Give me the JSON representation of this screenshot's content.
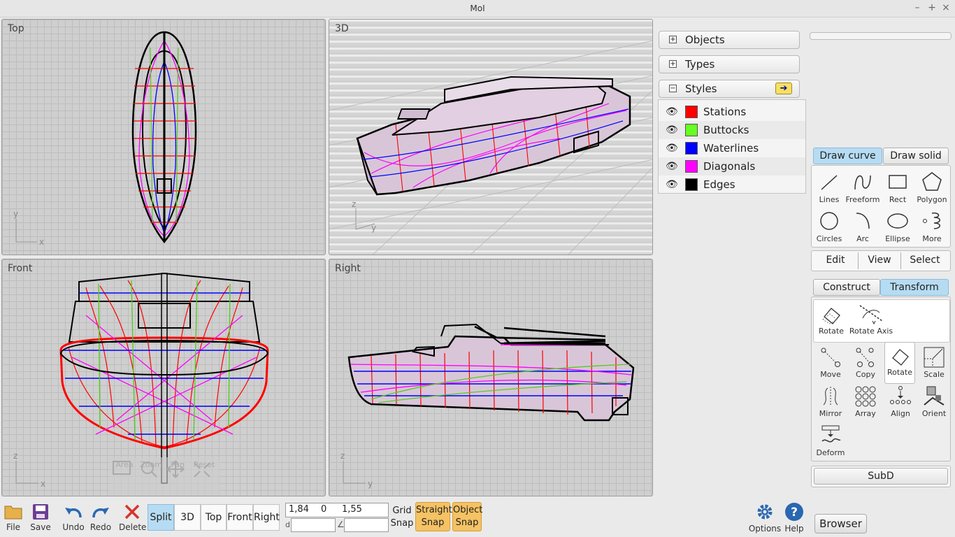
{
  "app": {
    "title": "MoI"
  },
  "viewports": {
    "top": "Top",
    "persp": "3D",
    "front": "Front",
    "right": "Right"
  },
  "nav": {
    "area": "Area",
    "zoom": "Zoom",
    "pan": "Pan",
    "reset": "Reset"
  },
  "panels": {
    "objects": "Objects",
    "types": "Types",
    "styles": "Styles"
  },
  "styles": [
    {
      "name": "Stations",
      "color": "#ff0000"
    },
    {
      "name": "Buttocks",
      "color": "#66ff22"
    },
    {
      "name": "Waterlines",
      "color": "#0000ff"
    },
    {
      "name": "Diagonals",
      "color": "#ff00ff"
    },
    {
      "name": "Edges",
      "color": "#000000"
    }
  ],
  "draw": {
    "tabs": [
      "Draw curve",
      "Draw solid"
    ],
    "tools": [
      "Lines",
      "Freeform",
      "Rect",
      "Polygon",
      "Circles",
      "Arc",
      "Ellipse",
      "More"
    ]
  },
  "edit_tabs": [
    "Edit",
    "View",
    "Select"
  ],
  "transform": {
    "tabs": [
      "Construct",
      "Transform"
    ],
    "sub": [
      "Rotate",
      "Rotate Axis"
    ],
    "tools": [
      "Move",
      "Copy",
      "Rotate",
      "Scale",
      "Mirror",
      "Array",
      "Align",
      "Orient",
      "Deform"
    ]
  },
  "subd": "SubD",
  "bottom": {
    "file": "File",
    "save": "Save",
    "undo": "Undo",
    "redo": "Redo",
    "delete": "Delete",
    "views": [
      "Split",
      "3D",
      "Top",
      "Front",
      "Right"
    ],
    "coord_x": "1,84",
    "coord_y": "0",
    "coord_z": "1,55",
    "d_label": "d",
    "grid_snap": [
      "Grid",
      "Snap"
    ],
    "straight_snap": [
      "Straight",
      "Snap"
    ],
    "object_snap": [
      "Object",
      "Snap"
    ],
    "options": "Options",
    "help": "Help",
    "browser": "Browser"
  }
}
